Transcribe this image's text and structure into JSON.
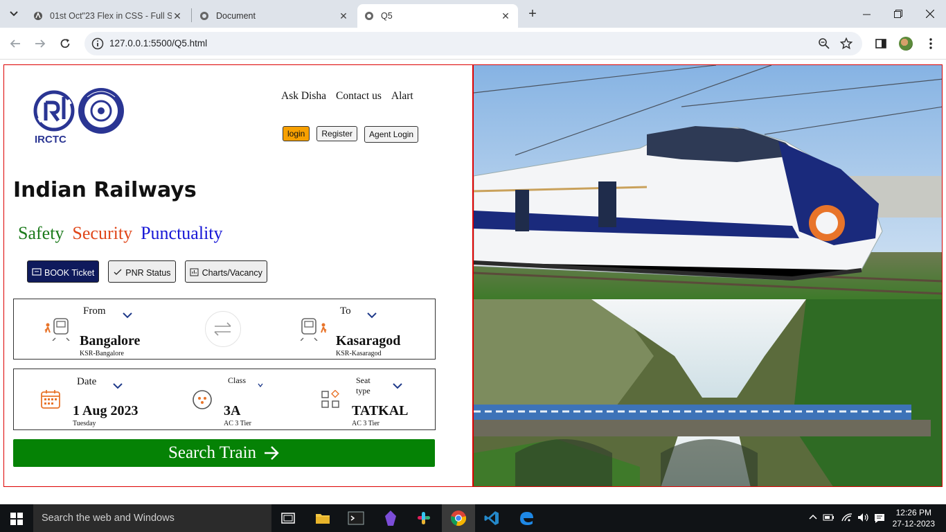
{
  "browser": {
    "tabs": [
      {
        "title": "01st Oct\"23 Flex in CSS - Full St",
        "active": false
      },
      {
        "title": "Document",
        "active": false
      },
      {
        "title": "Q5",
        "active": true
      }
    ],
    "url": "127.0.0.1:5500/Q5.html"
  },
  "header": {
    "logo_text": "IRCTC",
    "links": [
      "Ask Disha",
      "Contact us",
      "Alart"
    ],
    "buttons": {
      "login": "login",
      "register": "Register",
      "agent": "Agent Login"
    }
  },
  "hero": {
    "title": "Indian Railways",
    "motto": [
      "Safety",
      "Security",
      "Punctuality"
    ],
    "colors": {
      "safety": "#1d7b1d",
      "security": "#e0471a",
      "punctuality": "#1616d6"
    }
  },
  "options": [
    {
      "label": "BOOK Ticket",
      "icon": "ticket-icon",
      "active": true
    },
    {
      "label": "PNR Status",
      "icon": "check-icon",
      "active": false
    },
    {
      "label": "Charts/Vacancy",
      "icon": "chart-icon",
      "active": false
    }
  ],
  "journey": {
    "from": {
      "label": "From",
      "value": "Bangalore",
      "sub": "KSR-Bangalore"
    },
    "to": {
      "label": "To",
      "value": "Kasaragod",
      "sub": "KSR-Kasaragod"
    },
    "date": {
      "label": "Date",
      "value": "1 Aug 2023",
      "sub": "Tuesday"
    },
    "class": {
      "label": "Class",
      "value": "3A",
      "sub": "AC 3 Tier"
    },
    "seat": {
      "label_line1": "Seat",
      "label_line2": "type",
      "value": "TATKAL",
      "sub": "AC 3 Tier"
    }
  },
  "search": {
    "label": "Search Train",
    "color": "#058205"
  },
  "taskbar": {
    "search_placeholder": "Search the web and Windows",
    "time": "12:26 PM",
    "date": "27-12-2023"
  }
}
